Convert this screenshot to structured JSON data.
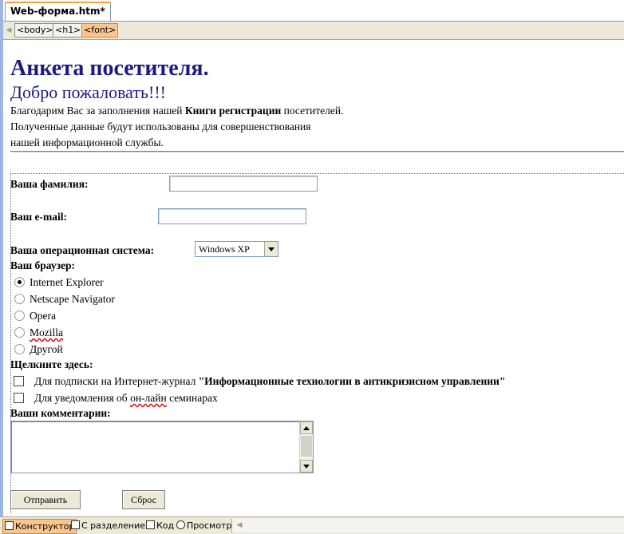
{
  "document_tab": {
    "title": "Web-форма.htm*"
  },
  "tag_selector": {
    "tags": [
      "<body>",
      "<h1>",
      "<font>"
    ]
  },
  "page": {
    "heading": "Анкета посетителя.",
    "subheading": "Добро пожаловать!!!",
    "intro": {
      "line1_before": "Благодарим Вас за заполнения нашей ",
      "line1_bold": "Книги регистрации",
      "line1_after": " посетителей.",
      "line2": "Полученные данные будут использованы для совершенствования",
      "line3": "нашей информационной службы."
    }
  },
  "form": {
    "surname_label": "Ваша фамилия:",
    "surname_value": "",
    "email_label": "Ваш e-mail:",
    "email_value": "",
    "os_label": "Ваша операционная система:",
    "os_selected": "Windows XP",
    "browser_label": "Ваш браузер:",
    "browser_options": [
      {
        "label": "Internet Explorer",
        "checked": true
      },
      {
        "label": "Netscape Navigator",
        "checked": false
      },
      {
        "label": "Opera",
        "checked": false
      },
      {
        "label": "Mozilla",
        "checked": false
      },
      {
        "label": "Другой",
        "checked": false
      }
    ],
    "click_label": "Щелкните здесь:",
    "subscribe_text": "Для подписки на Интернет-журнал ",
    "subscribe_bold": "\"Информационные технологии в антикризисном управлении\"",
    "notify_before": "Для уведомления об ",
    "notify_underlined": "он-лайн",
    "notify_after": " семинарах",
    "comments_label": "Ваши комментарии:",
    "submit_label": "Отправить",
    "reset_label": "Сброс"
  },
  "view_tabs": {
    "design": "Конструктор",
    "split": "С разделением",
    "code": "Код",
    "preview": "Просмотр"
  }
}
